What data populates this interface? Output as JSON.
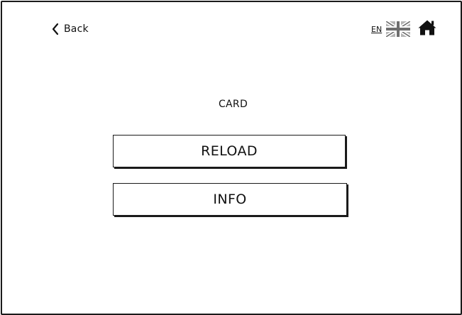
{
  "nav": {
    "back_label": "Back",
    "back_icon": "chevron-left-icon",
    "language": {
      "code": "EN",
      "flag_icon": "uk-flag-icon"
    },
    "home_icon": "home-icon"
  },
  "main": {
    "title": "CARD",
    "buttons": [
      {
        "label": "RELOAD"
      },
      {
        "label": "INFO"
      }
    ]
  }
}
